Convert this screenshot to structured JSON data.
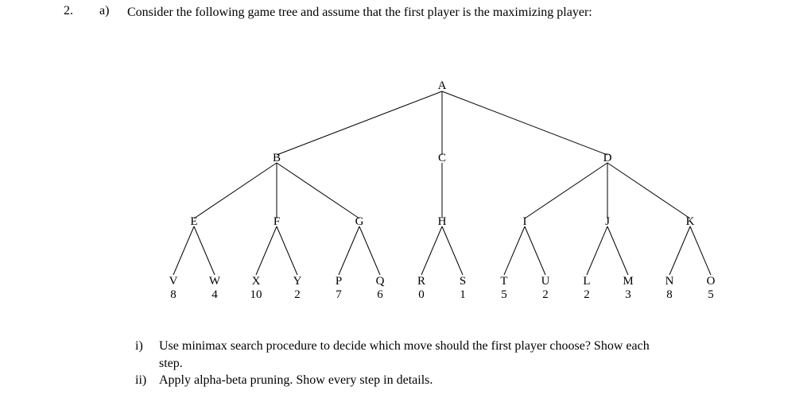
{
  "question": {
    "number": "2.",
    "part": "a)",
    "prompt": "Consider the following game tree and assume that the first player is the maximizing player:",
    "subparts": [
      {
        "marker": "i)",
        "text": "Use minimax search procedure to decide which move should the first player choose? Show each step."
      },
      {
        "marker": "ii)",
        "text": "Apply alpha-beta pruning. Show every step in details."
      }
    ]
  },
  "tree": {
    "root": "A",
    "level2": [
      "B",
      "C",
      "D"
    ],
    "level3": [
      "E",
      "F",
      "G",
      "H",
      "I",
      "J",
      "K"
    ],
    "leaves": [
      {
        "label": "V",
        "value": 8
      },
      {
        "label": "W",
        "value": 4
      },
      {
        "label": "X",
        "value": 10
      },
      {
        "label": "Y",
        "value": 2
      },
      {
        "label": "P",
        "value": 7
      },
      {
        "label": "Q",
        "value": 6
      },
      {
        "label": "R",
        "value": 0
      },
      {
        "label": "S",
        "value": 1
      },
      {
        "label": "T",
        "value": 5
      },
      {
        "label": "U",
        "value": 2
      },
      {
        "label": "L",
        "value": 2
      },
      {
        "label": "M",
        "value": 3
      },
      {
        "label": "N",
        "value": 8
      },
      {
        "label": "O",
        "value": 5
      }
    ],
    "structure": {
      "A": [
        "B",
        "C",
        "D"
      ],
      "B": [
        "E",
        "F",
        "G"
      ],
      "C": [
        "H"
      ],
      "D": [
        "I",
        "J",
        "K"
      ],
      "E": [
        "V",
        "W"
      ],
      "F": [
        "X",
        "Y"
      ],
      "G": [
        "P",
        "Q"
      ],
      "H": [
        "R",
        "S"
      ],
      "I": [
        "T",
        "U"
      ],
      "J": [
        "L",
        "M"
      ],
      "K": [
        "N",
        "O"
      ]
    }
  },
  "chart_data": {
    "type": "table",
    "title": "Game tree leaf values",
    "labels": [
      "V",
      "W",
      "X",
      "Y",
      "P",
      "Q",
      "R",
      "S",
      "T",
      "U",
      "L",
      "M",
      "N",
      "O"
    ],
    "values": [
      8,
      4,
      10,
      2,
      7,
      6,
      0,
      1,
      5,
      2,
      2,
      3,
      8,
      5
    ]
  }
}
